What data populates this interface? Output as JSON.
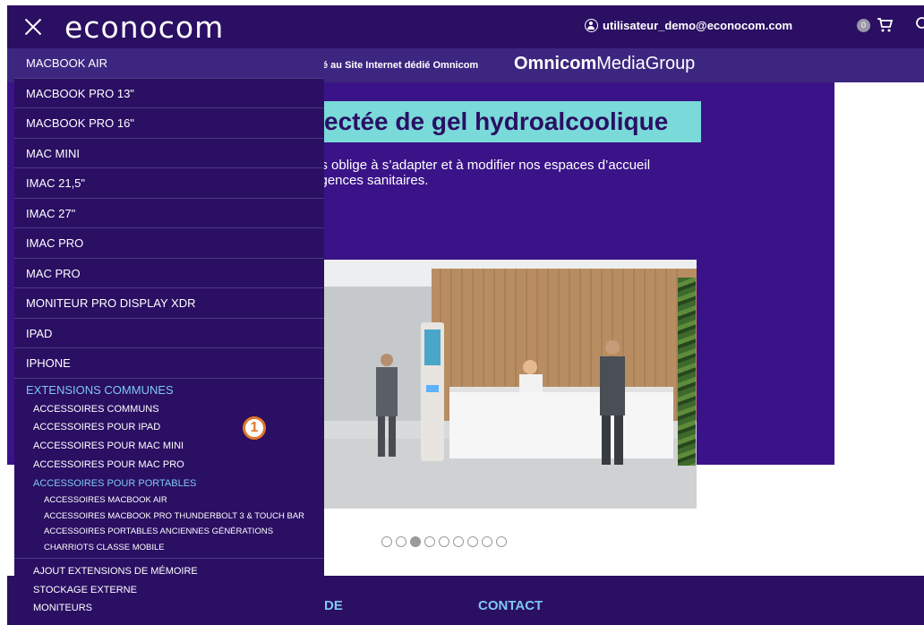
{
  "header": {
    "logo": "econocom",
    "user_email": "utilisateur_demo@econocom.com",
    "cart_count": "0"
  },
  "subbar": {
    "text": "é au Site Internet dédié Omnicom",
    "brand_bold": "Omnicom",
    "brand_rest": "MediaGroup"
  },
  "hero": {
    "title": "ectée de gel hydroalcoolique",
    "description": "us oblige à s’adapter et à modifier nos espaces d’accueil tigences sanitaires."
  },
  "carousel": {
    "total": 9,
    "active_index": 2
  },
  "footer": {
    "links": [
      "DE",
      "CONTACT"
    ]
  },
  "menu": {
    "items": [
      "MACBOOK AIR",
      "MACBOOK PRO 13\"",
      "MACBOOK PRO 16\"",
      "MAC MINI",
      "IMAC 21,5\"",
      "IMAC 27\"",
      "IMAC PRO",
      "MAC PRO",
      "MONITEUR PRO DISPLAY XDR",
      "IPAD",
      "IPHONE"
    ],
    "section": "EXTENSIONS COMMUNES",
    "sub_items": [
      "ACCESSOIRES COMMUNS",
      "ACCESSOIRES POUR IPAD",
      "ACCESSOIRES POUR MAC MINI",
      "ACCESSOIRES POUR MAC PRO",
      "ACCESSOIRES POUR PORTABLES"
    ],
    "subsub_items": [
      "ACCESSOIRES MACBOOK AIR",
      "ACCESSOIRES MACBOOK PRO THUNDERBOLT 3 & TOUCH BAR",
      "ACCESSOIRES PORTABLES ANCIENNES GÉNÉRATIONS",
      "CHARRIOTS CLASSE MOBILE"
    ],
    "bottom_items": [
      "AJOUT EXTENSIONS DE MÉMOIRE",
      "STOCKAGE EXTERNE",
      "MONITEURS"
    ]
  },
  "annotation": {
    "label": "1"
  },
  "colors": {
    "nav_bg": "#2a0f63",
    "subbar_bg": "#3d2680",
    "hero_bg": "#3a1388",
    "hero_title_bg": "#7ad9d9",
    "accent_link": "#7ec8f0",
    "annotation": "#e2772a"
  },
  "icons": [
    "close-icon",
    "user-icon",
    "cart-icon",
    "search-icon"
  ]
}
